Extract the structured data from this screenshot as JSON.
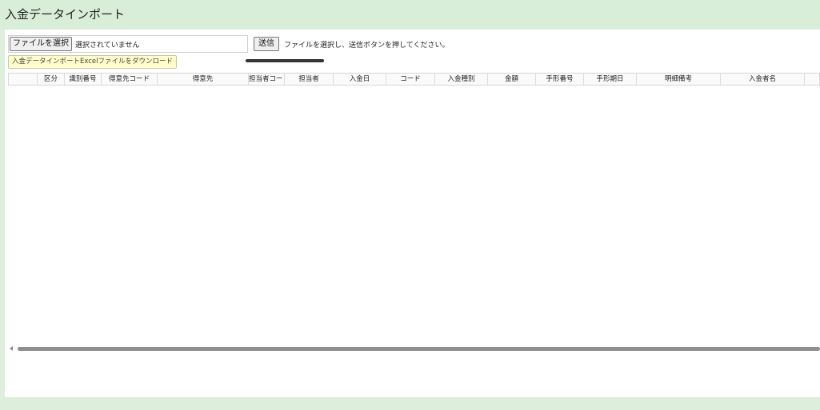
{
  "header": {
    "title": "入金データインポート"
  },
  "upload": {
    "choose_label": "ファイルを選択",
    "file_status": "選択されていません",
    "send_label": "送信",
    "hint": "ファイルを選択し、送信ボタンを押してください。"
  },
  "download": {
    "label": "入金データインポートExcelファイルをダウンロード"
  },
  "grid": {
    "columns": [
      {
        "label": ""
      },
      {
        "label": "区分"
      },
      {
        "label": "識別番号"
      },
      {
        "label": "得意先コード"
      },
      {
        "label": "得意先"
      },
      {
        "label": "担当者コード"
      },
      {
        "label": "担当者"
      },
      {
        "label": "入金日"
      },
      {
        "label": "コード"
      },
      {
        "label": "入金種別"
      },
      {
        "label": "金額"
      },
      {
        "label": "手形番号"
      },
      {
        "label": "手形期日"
      },
      {
        "label": "明細備考"
      },
      {
        "label": "入金者名"
      },
      {
        "label": ""
      }
    ]
  }
}
